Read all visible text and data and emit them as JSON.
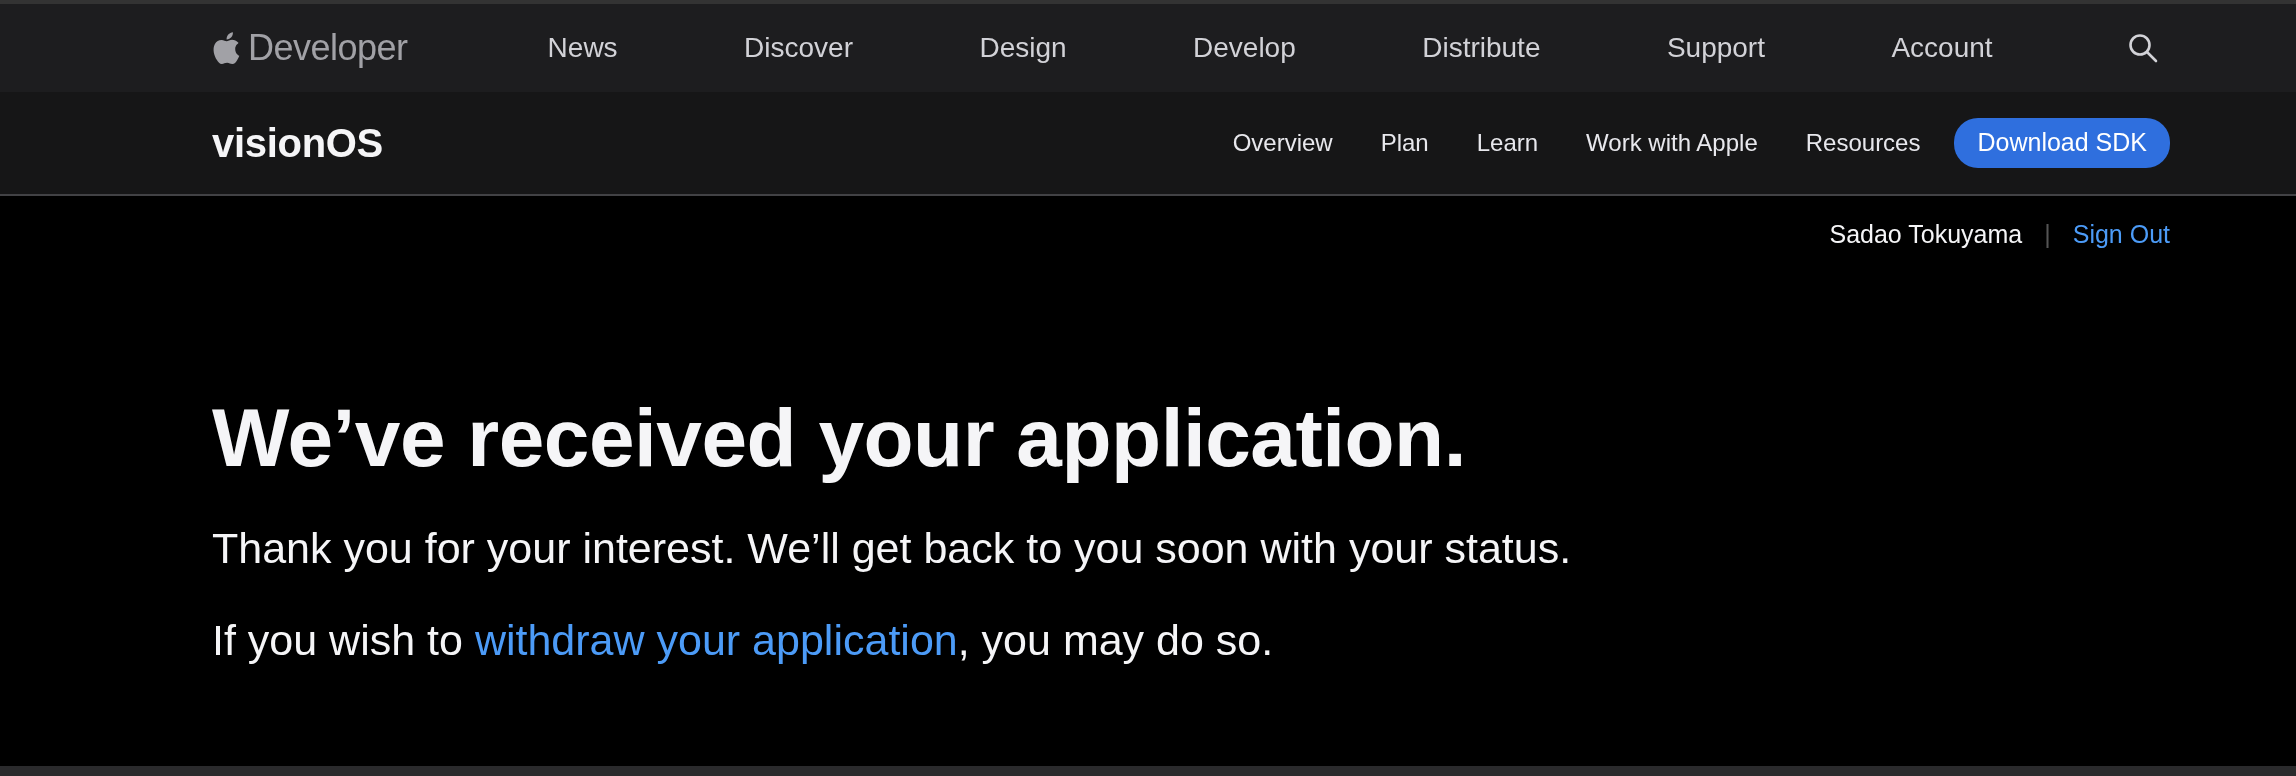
{
  "global_nav": {
    "logo_text": "Developer",
    "items": [
      {
        "label": "News"
      },
      {
        "label": "Discover"
      },
      {
        "label": "Design"
      },
      {
        "label": "Develop"
      },
      {
        "label": "Distribute"
      },
      {
        "label": "Support"
      },
      {
        "label": "Account"
      }
    ]
  },
  "local_nav": {
    "title": "visionOS",
    "links": [
      {
        "label": "Overview"
      },
      {
        "label": "Plan"
      },
      {
        "label": "Learn"
      },
      {
        "label": "Work with Apple"
      },
      {
        "label": "Resources"
      }
    ],
    "button": "Download SDK"
  },
  "user_bar": {
    "name": "Sadao Tokuyama",
    "separator": "|",
    "sign_out": "Sign Out"
  },
  "content": {
    "heading": "We’ve received your application.",
    "message": "Thank you for your interest. We’ll get back to you soon with your status.",
    "withdraw": {
      "before": "If you wish to ",
      "link": "withdraw your application",
      "after": ", you may do so."
    }
  }
}
